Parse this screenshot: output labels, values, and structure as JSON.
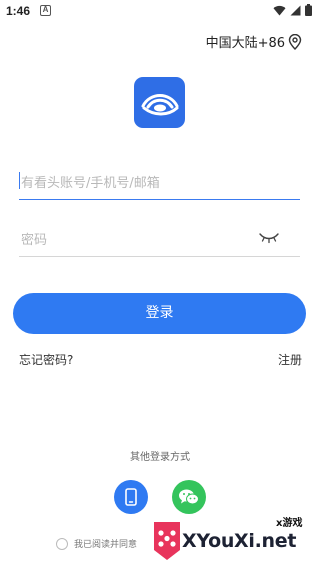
{
  "status_bar": {
    "time": "1:46",
    "notification_glyph": "A",
    "icons": [
      "wifi-icon",
      "signal-icon",
      "battery-icon"
    ]
  },
  "region": {
    "label": "中国大陆+86",
    "icon": "location-pin-icon"
  },
  "logo": {
    "icon": "app-logo-eye",
    "color": "#2f6ee6"
  },
  "login_form": {
    "account_placeholder": "有看头账号/手机号/邮箱",
    "password_placeholder": "密码",
    "password_toggle_icon": "eye-closed-icon",
    "submit_label": "登录",
    "forgot_label": "忘记密码?",
    "register_label": "注册"
  },
  "other_login": {
    "title": "其他登录方式",
    "methods": [
      {
        "name": "phone",
        "icon": "phone-icon",
        "color": "#2f7af2"
      },
      {
        "name": "wechat",
        "icon": "wechat-icon",
        "color": "#34c45c"
      }
    ]
  },
  "agreement": {
    "text": "我已阅读并同意"
  },
  "watermark": {
    "small": "x游戏",
    "big": "XYouXi.net"
  },
  "colors": {
    "accent": "#2f7af2",
    "wechat": "#34c45c"
  }
}
